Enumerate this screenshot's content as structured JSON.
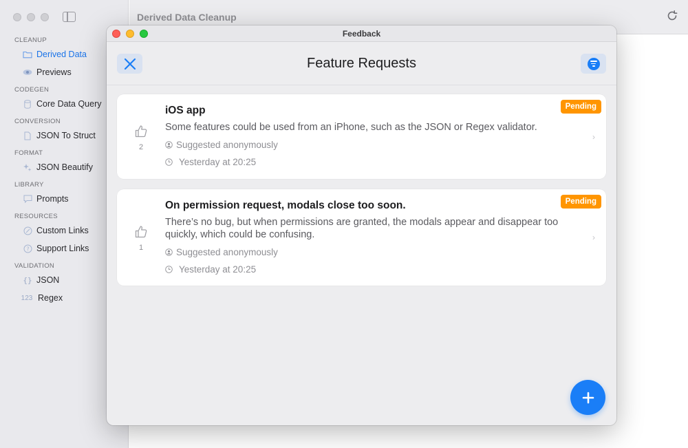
{
  "app": {
    "title": "Derived Data Cleanup",
    "sidebar": {
      "sections": [
        {
          "title": "CLEANUP",
          "items": [
            {
              "label": "Derived Data",
              "icon": "folder-icon",
              "active": true
            },
            {
              "label": "Previews",
              "icon": "eye-icon",
              "active": false
            }
          ]
        },
        {
          "title": "CODEGEN",
          "items": [
            {
              "label": "Core Data Query",
              "icon": "database-icon",
              "active": false
            }
          ]
        },
        {
          "title": "CONVERSION",
          "items": [
            {
              "label": "JSON To Struct",
              "icon": "document-icon",
              "active": false
            }
          ]
        },
        {
          "title": "FORMAT",
          "items": [
            {
              "label": "JSON Beautify",
              "icon": "sparkle-icon",
              "active": false
            }
          ]
        },
        {
          "title": "LIBRARY",
          "items": [
            {
              "label": "Prompts",
              "icon": "message-icon",
              "active": false
            }
          ]
        },
        {
          "title": "RESOURCES",
          "items": [
            {
              "label": "Custom Links",
              "icon": "link-icon",
              "active": false
            },
            {
              "label": "Support Links",
              "icon": "question-icon",
              "active": false
            }
          ]
        },
        {
          "title": "VALIDATION",
          "items": [
            {
              "label": "JSON",
              "icon": "braces-icon",
              "active": false
            },
            {
              "label": "Regex",
              "icon": "number-icon",
              "active": false
            }
          ]
        }
      ]
    }
  },
  "modal": {
    "window_title": "Feedback",
    "toolbar_title": "Feature Requests",
    "requests": [
      {
        "title": "iOS app",
        "description": "Some features could be used from an iPhone, such as the JSON or Regex validator.",
        "votes": "2",
        "author": "Suggested anonymously",
        "time": "Yesterday at 20:25",
        "status": "Pending"
      },
      {
        "title": "On permission request, modals close too soon.",
        "description": "There’s no bug, but when permissions are granted, the modals appear and disappear too quickly, which could be confusing.",
        "votes": "1",
        "author": "Suggested anonymously",
        "time": "Yesterday at 20:25",
        "status": "Pending"
      }
    ]
  },
  "colors": {
    "accent": "#1a7ef7",
    "pending": "#ff9500",
    "sidebar_active": "#1a73e8"
  }
}
